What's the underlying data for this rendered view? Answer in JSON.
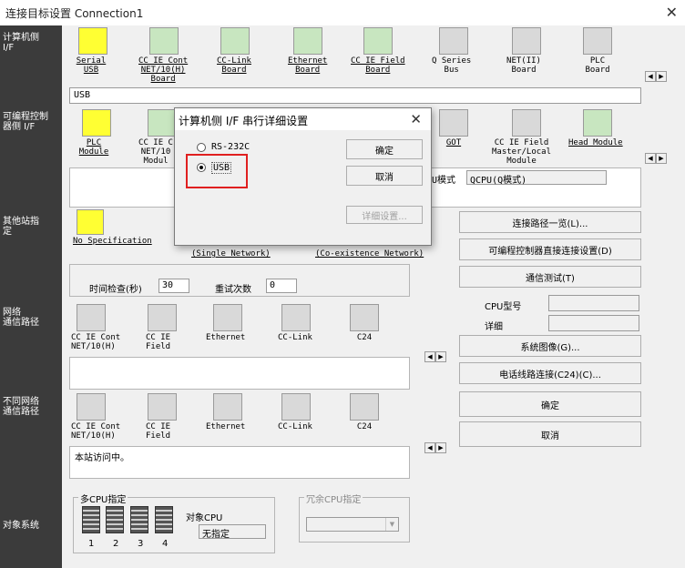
{
  "window": {
    "title": "连接目标设置 Connection1",
    "close_glyph": "✕"
  },
  "left_labels": {
    "pc_if": "计算机侧\nI/F",
    "plc_if": "可编程控制\n器侧 I/F",
    "other_station": "其他站指\n定",
    "network_route": "网络\n通信路径",
    "diff_network": "不同网络\n通信路径",
    "target_system": "对象系统"
  },
  "pc_interfaces": [
    {
      "label": "Serial\nUSB",
      "icon": "serial-usb-icon"
    },
    {
      "label": "CC IE Cont\nNET/10(H)\nBoard",
      "icon": "cc-ie-cont-board-icon"
    },
    {
      "label": "CC-Link\nBoard",
      "icon": "cc-link-board-icon"
    },
    {
      "label": "Ethernet\nBoard",
      "icon": "ethernet-board-icon"
    },
    {
      "label": "CC IE Field\nBoard",
      "icon": "cc-ie-field-board-icon"
    },
    {
      "label": "Q Series\nBus",
      "icon": "q-series-bus-icon"
    },
    {
      "label": "NET(II)\nBoard",
      "icon": "net-ii-board-icon"
    },
    {
      "label": "PLC\nBoard",
      "icon": "plc-board-icon"
    }
  ],
  "pc_if_selected": "USB",
  "plc_interfaces": [
    {
      "label": "PLC\nModule",
      "icon": "plc-module-icon"
    },
    {
      "label": "CC IE C\nNET/10\nModul",
      "icon": "cc-ie-module-icon"
    },
    {
      "label": "GOT",
      "icon": "got-icon"
    },
    {
      "label": "CC IE Field\nMaster/Local\nModule",
      "icon": "cc-ie-field-master-icon"
    },
    {
      "label": "Head Module",
      "icon": "head-module-icon"
    }
  ],
  "plc_mode_label": "U模式",
  "plc_mode_value": "QCPU(Q模式)",
  "other_station": {
    "no_spec": "No Specification",
    "single_network": "(Single Network)",
    "coexistence_network": "(Co-existence Network)",
    "time_check_label": "时间检查(秒)",
    "time_check_value": "30",
    "retry_label": "重试次数",
    "retry_value": "0"
  },
  "network_items": [
    {
      "label": "CC IE Cont\nNET/10(H)"
    },
    {
      "label": "CC IE\nField"
    },
    {
      "label": "Ethernet"
    },
    {
      "label": "CC-Link"
    },
    {
      "label": "C24"
    }
  ],
  "diff_network_items": [
    {
      "label": "CC IE Cont\nNET/10(H)"
    },
    {
      "label": "CC IE\nField"
    },
    {
      "label": "Ethernet"
    },
    {
      "label": "CC-Link"
    },
    {
      "label": "C24"
    }
  ],
  "status_text": "本站访问中。",
  "multi_cpu": {
    "group": "多CPU指定",
    "nums": [
      "1",
      "2",
      "3",
      "4"
    ],
    "target_cpu_label": "对象CPU",
    "target_cpu_value": "无指定"
  },
  "redundant_cpu": {
    "group": "冗余CPU指定"
  },
  "right_buttons": {
    "route_list": "连接路径一览(L)...",
    "direct_connect": "可编程控制器直接连接设置(D)",
    "comm_test": "通信测试(T)",
    "cpu_model_label": "CPU型号",
    "detail_label": "详细",
    "system_image": "系统图像(G)...",
    "phone_line": "电话线路连接(C24)(C)...",
    "ok": "确定",
    "cancel": "取消"
  },
  "dialog": {
    "title": "计算机侧 I/F 串行详细设置",
    "close_glyph": "✕",
    "opt_rs232c": "RS-232C",
    "opt_usb": "USB",
    "ok": "确定",
    "cancel": "取消",
    "detail": "详细设置..."
  },
  "arrow_left": "◀",
  "arrow_right": "▶",
  "colors": {
    "highlight": "#e02020",
    "sidebar": "#3b3b3b"
  }
}
